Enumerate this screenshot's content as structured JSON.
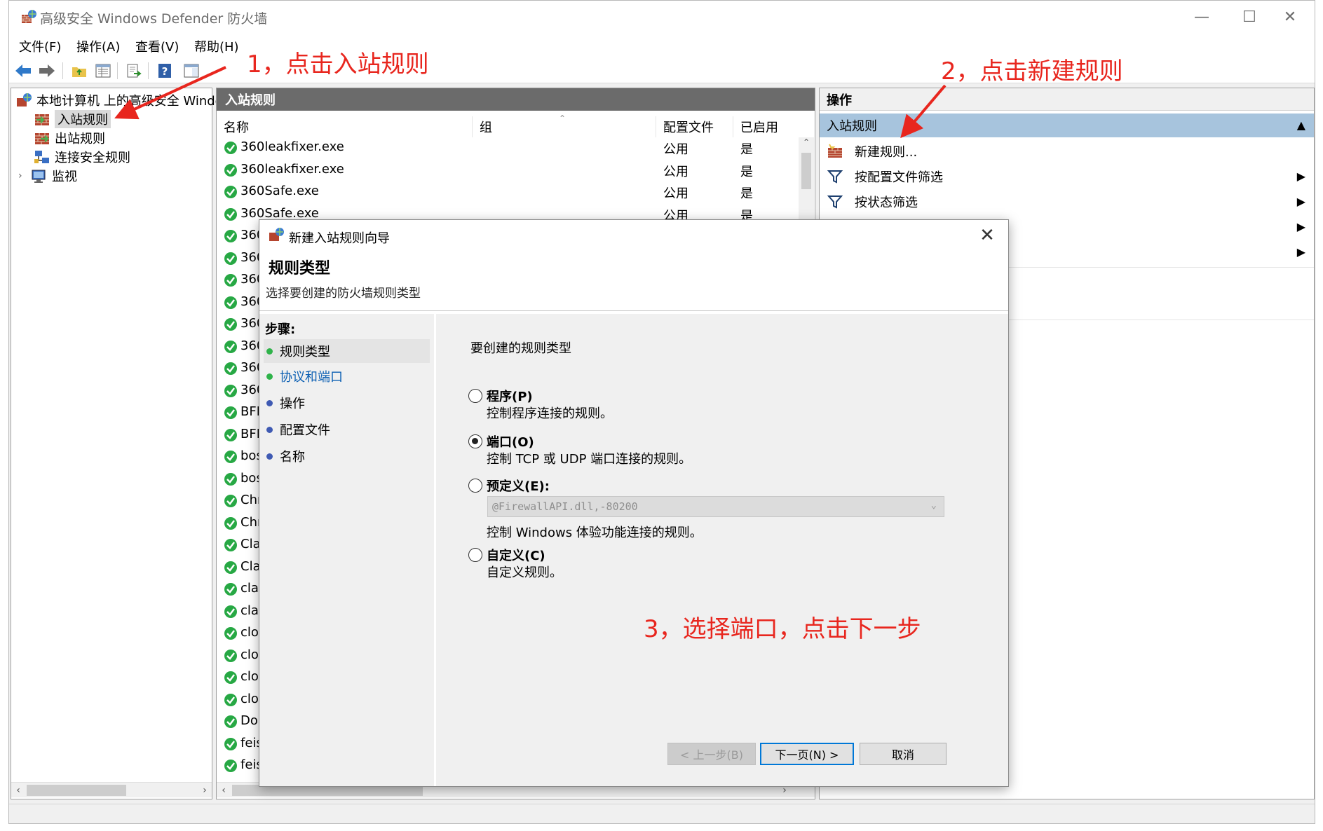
{
  "window": {
    "title": "高级安全 Windows Defender 防火墙",
    "controls": {
      "minimize": "—",
      "maximize": "☐",
      "close": "✕"
    }
  },
  "menubar": [
    "文件(F)",
    "操作(A)",
    "查看(V)",
    "帮助(H)"
  ],
  "tree": {
    "root": "本地计算机 上的高级安全 Windows Defender 防火墙",
    "items": [
      "入站规则",
      "出站规则",
      "连接安全规则",
      "监视"
    ]
  },
  "list": {
    "header": "入站规则",
    "columns": [
      "名称",
      "组",
      "配置文件",
      "已启用"
    ],
    "rows": [
      {
        "name": "360leakfixer.exe",
        "profile": "公用",
        "enabled": "是"
      },
      {
        "name": "360leakfixer.exe",
        "profile": "公用",
        "enabled": "是"
      },
      {
        "name": "360Safe.exe",
        "profile": "公用",
        "enabled": "是"
      },
      {
        "name": "360Safe.exe",
        "profile": "公用",
        "enabled": "是"
      },
      {
        "name": "360",
        "profile": "",
        "enabled": ""
      },
      {
        "name": "360",
        "profile": "",
        "enabled": ""
      },
      {
        "name": "360",
        "profile": "",
        "enabled": ""
      },
      {
        "name": "360",
        "profile": "",
        "enabled": ""
      },
      {
        "name": "360",
        "profile": "",
        "enabled": ""
      },
      {
        "name": "360",
        "profile": "",
        "enabled": ""
      },
      {
        "name": "360",
        "profile": "",
        "enabled": ""
      },
      {
        "name": "360",
        "profile": "",
        "enabled": ""
      },
      {
        "name": "BFD",
        "profile": "",
        "enabled": ""
      },
      {
        "name": "BFD",
        "profile": "",
        "enabled": ""
      },
      {
        "name": "bos",
        "profile": "",
        "enabled": ""
      },
      {
        "name": "bos",
        "profile": "",
        "enabled": ""
      },
      {
        "name": "Chr",
        "profile": "",
        "enabled": ""
      },
      {
        "name": "Chr",
        "profile": "",
        "enabled": ""
      },
      {
        "name": "Cla",
        "profile": "",
        "enabled": ""
      },
      {
        "name": "Cla",
        "profile": "",
        "enabled": ""
      },
      {
        "name": "clas",
        "profile": "",
        "enabled": ""
      },
      {
        "name": "clas",
        "profile": "",
        "enabled": ""
      },
      {
        "name": "clo",
        "profile": "",
        "enabled": ""
      },
      {
        "name": "clo",
        "profile": "",
        "enabled": ""
      },
      {
        "name": "clo",
        "profile": "",
        "enabled": ""
      },
      {
        "name": "clo",
        "profile": "",
        "enabled": ""
      },
      {
        "name": "Do",
        "profile": "",
        "enabled": ""
      },
      {
        "name": "feis",
        "profile": "",
        "enabled": ""
      },
      {
        "name": "feis",
        "profile": "",
        "enabled": ""
      }
    ]
  },
  "actions": {
    "header": "操作",
    "section": "入站规则",
    "items": [
      "新建规则...",
      "按配置文件筛选",
      "按状态筛选"
    ]
  },
  "dialog": {
    "title": "新建入站规则向导",
    "heading": "规则类型",
    "subtitle": "选择要创建的防火墙规则类型",
    "steps_title": "步骤:",
    "steps": [
      "规则类型",
      "协议和端口",
      "操作",
      "配置文件",
      "名称"
    ],
    "prompt": "要创建的规则类型",
    "options": [
      {
        "label": "程序(P)",
        "desc": "控制程序连接的规则。",
        "selected": false
      },
      {
        "label": "端口(O)",
        "desc": "控制 TCP 或 UDP 端口连接的规则。",
        "selected": true
      },
      {
        "label": "预定义(E):",
        "desc": "控制 Windows 体验功能连接的规则。",
        "selected": false
      },
      {
        "label": "自定义(C)",
        "desc": "自定义规则。",
        "selected": false
      }
    ],
    "predefined_value": "@FirewallAPI.dll,-80200",
    "buttons": {
      "back": "< 上一步(B)",
      "next": "下一页(N) >",
      "cancel": "取消"
    }
  },
  "annotations": {
    "step1": "1，点击入站规则",
    "step2": "2，点击新建规则",
    "step3": "3，选择端口，点击下一步",
    "color": "#e8261e"
  }
}
